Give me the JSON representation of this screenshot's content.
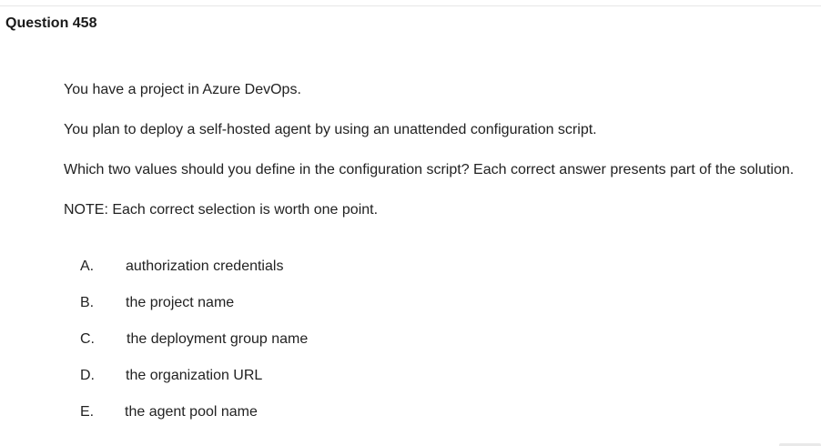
{
  "question": {
    "title": "Question 458",
    "paragraphs": [
      "You have a project in Azure DevOps.",
      "You plan to deploy a self-hosted agent by using an unattended configuration script.",
      "Which two values should you define in the configuration script? Each correct answer presents part of the solution.",
      "NOTE: Each correct selection is worth one point."
    ],
    "options": [
      {
        "letter": "A.",
        "text": "authorization credentials"
      },
      {
        "letter": "B.",
        "text": "the project name"
      },
      {
        "letter": "C.",
        "text": "the deployment group name"
      },
      {
        "letter": "D.",
        "text": "the organization URL"
      },
      {
        "letter": "E.",
        "text": "the agent pool name"
      }
    ]
  }
}
